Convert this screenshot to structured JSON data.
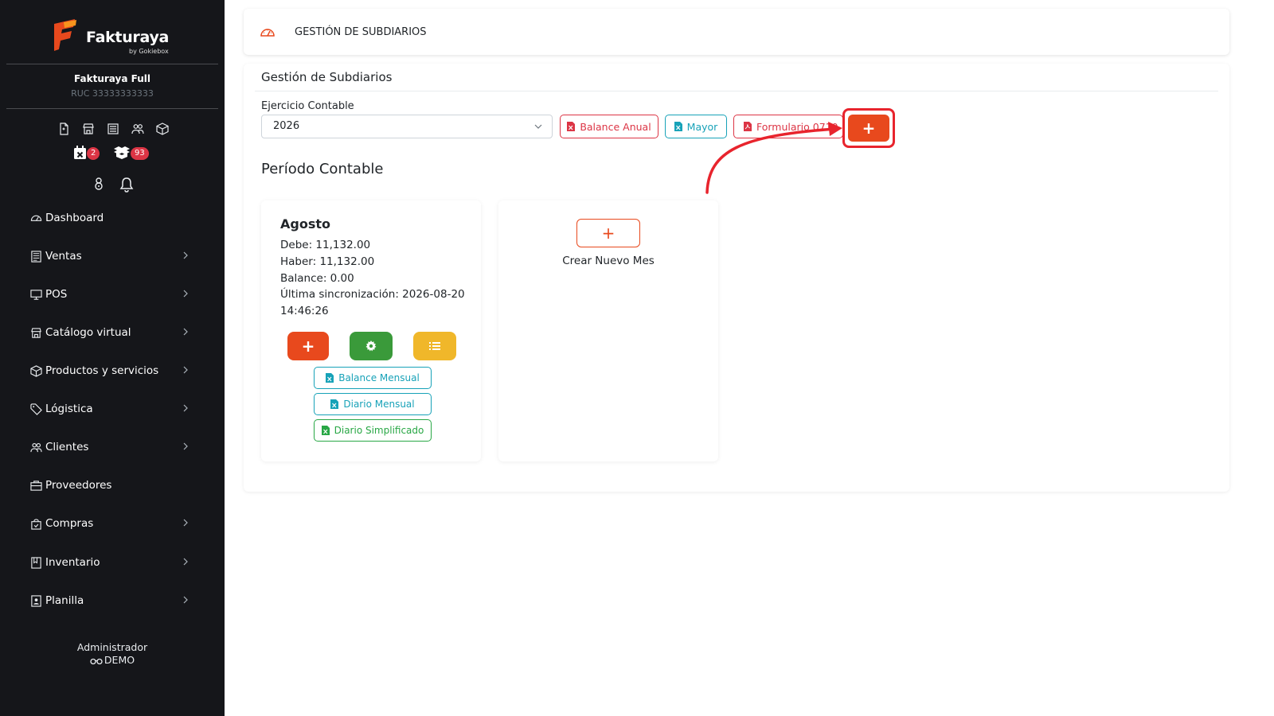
{
  "brand": {
    "name": "Fakturaya",
    "sub": "by Gokiebox",
    "accent": "#e8491d"
  },
  "company": {
    "name": "Fakturaya Full",
    "ruc": "RUC 33333333333"
  },
  "quick_icons": [
    "document-icon",
    "store-icon",
    "list-icon",
    "users-icon",
    "box-icon"
  ],
  "badges": {
    "calendar_count": "2",
    "boxes_count": "93"
  },
  "nav": {
    "items": [
      {
        "label": "Dashboard",
        "icon": "gauge-icon",
        "has_children": false
      },
      {
        "label": "Ventas",
        "icon": "receipt-icon",
        "has_children": true
      },
      {
        "label": "POS",
        "icon": "monitor-icon",
        "has_children": true
      },
      {
        "label": "Catálogo virtual",
        "icon": "store-icon",
        "has_children": true
      },
      {
        "label": "Productos y servicios",
        "icon": "box-icon",
        "has_children": true
      },
      {
        "label": "Lógistica",
        "icon": "tag-icon",
        "has_children": true
      },
      {
        "label": "Clientes",
        "icon": "users-icon",
        "has_children": true
      },
      {
        "label": "Proveedores",
        "icon": "briefcase-icon",
        "has_children": false
      },
      {
        "label": "Compras",
        "icon": "shopping-bag-icon",
        "has_children": true
      },
      {
        "label": "Inventario",
        "icon": "book-icon",
        "has_children": true
      },
      {
        "label": "Planilla",
        "icon": "id-badge-icon",
        "has_children": true
      }
    ]
  },
  "user": {
    "role": "Administrador",
    "name": "DEMO"
  },
  "header": {
    "title": "GESTIÓN DE SUBDIARIOS"
  },
  "main": {
    "title": "Gestión de Subdiarios",
    "ejercicio_label": "Ejercicio Contable",
    "ejercicio_value": "2026",
    "buttons": {
      "balance_anual": "Balance Anual",
      "mayor": "Mayor",
      "formulario": "Formulario 0710",
      "add": "+"
    },
    "period_title": "Período Contable",
    "period": {
      "month": "Agosto",
      "debe": "Debe: 11,132.00",
      "haber": "Haber: 11,132.00",
      "balance": "Balance: 0.00",
      "sync_line1": "Última sincronización: 2026-08-20",
      "sync_line2": "14:46:26",
      "balance_mensual": "Balance Mensual",
      "diario_mensual": "Diario Mensual",
      "diario_simplificado": "Diario Simplificado"
    },
    "new_month": {
      "label": "Crear Nuevo Mes",
      "button": "+"
    }
  },
  "colors": {
    "sidebar_bg": "#15161a",
    "danger": "#dc3545",
    "info": "#17a2b8",
    "success": "#28a745",
    "orange": "#e8491d",
    "green_solid": "#3a9a3a",
    "yellow_solid": "#f0b72a",
    "highlight": "#e8242d"
  }
}
